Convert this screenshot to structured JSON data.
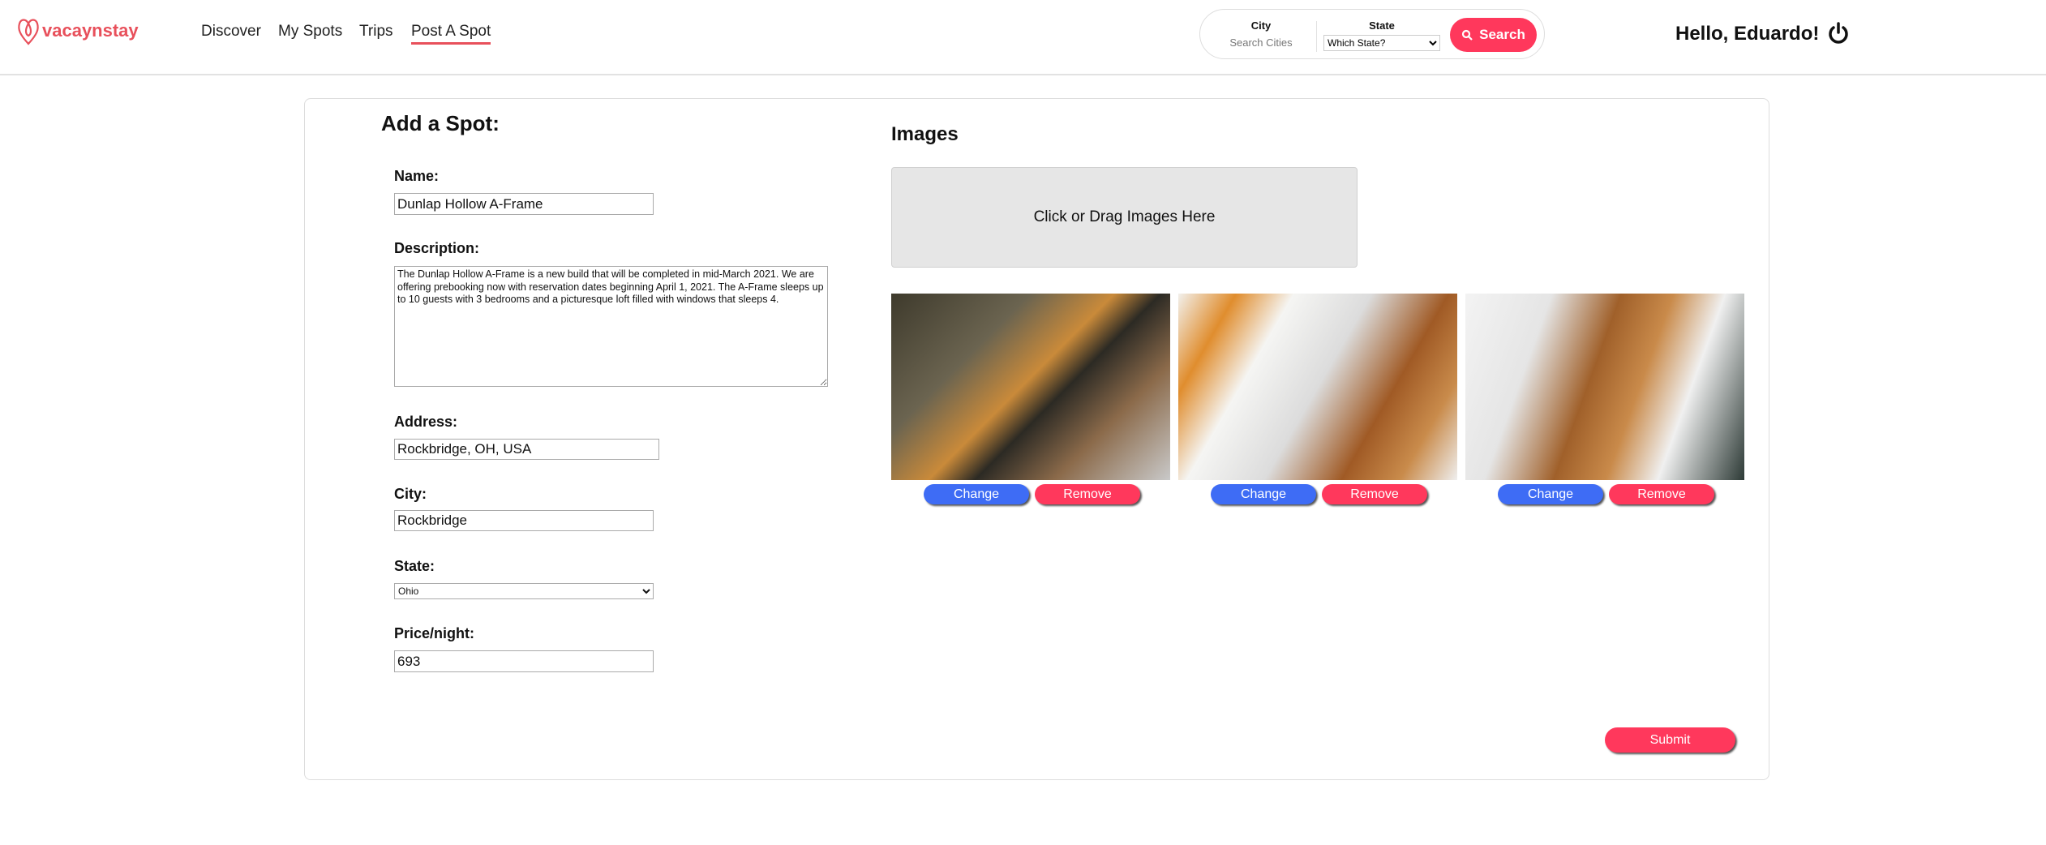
{
  "header": {
    "logo": "vacaynstay",
    "nav": [
      "Discover",
      "My Spots",
      "Trips",
      "Post A Spot"
    ],
    "active_nav": "Post A Spot",
    "search": {
      "city_label": "City",
      "city_placeholder": "Search Cities",
      "state_label": "State",
      "state_selected": "Which State?",
      "button": "Search"
    },
    "greeting": "Hello, Eduardo!",
    "brand_color": "#ff385c"
  },
  "form": {
    "title": "Add a Spot:",
    "name_label": "Name:",
    "name_value": "Dunlap Hollow A-Frame",
    "description_label": "Description:",
    "description_value": "The Dunlap Hollow A-Frame is a new build that will be completed in mid-March 2021. We are offering prebooking now with reservation dates beginning April 1, 2021. The A-Frame sleeps up to 10 guests with 3 bedrooms and a picturesque loft filled with windows that sleeps 4.",
    "address_label": "Address:",
    "address_value": "Rockbridge, OH, USA",
    "city_label": "City:",
    "city_value": "Rockbridge",
    "state_label": "State:",
    "state_value": "Ohio",
    "price_label": "Price/night:",
    "price_value": "693",
    "submit": "Submit"
  },
  "images": {
    "title": "Images",
    "dropzone": "Click or Drag Images Here",
    "change": "Change",
    "remove": "Remove",
    "count": 3
  }
}
